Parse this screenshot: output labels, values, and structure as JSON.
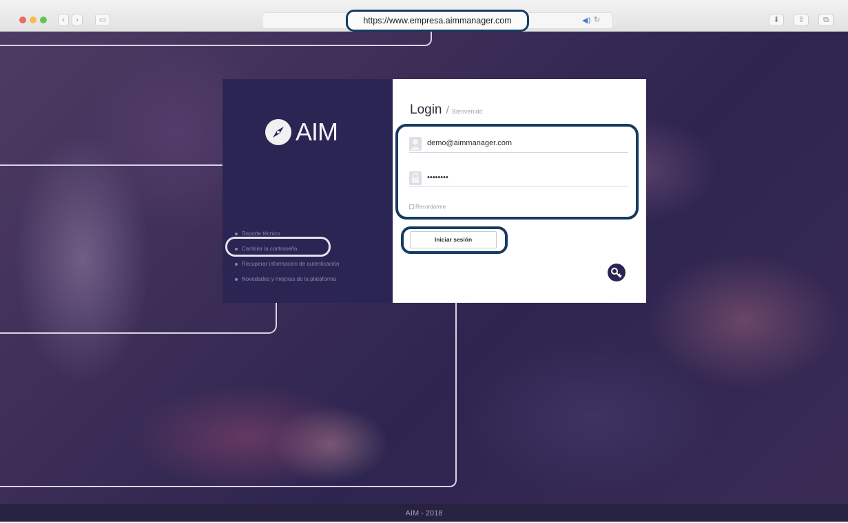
{
  "browser": {
    "url": "https://www.empresa.aimmanager.com",
    "back_glyph": "‹",
    "forward_glyph": "›",
    "sidebar_glyph": "▭",
    "audio_glyph": "◀)",
    "reload_glyph": "↻",
    "download_glyph": "⬇",
    "share_glyph": "⇧",
    "tabs_glyph": "⧉"
  },
  "brand": {
    "logo_text": "AIM",
    "icon": "compass-icon"
  },
  "sidebar_links": [
    "Soporte técnico",
    "Cambiar la contraseña",
    "Recuperar información de autenticación",
    "Novedades y mejoras de la plataforma"
  ],
  "login": {
    "title": "Login",
    "subtitle": "Bienvenido",
    "username_value": "demo@aimmanager.com",
    "password_value": "••••••••",
    "remember_label": "Recordarme",
    "submit_label": "Iniciar sesión",
    "key_glyph": "🔍"
  },
  "footer": {
    "text": "AIM - 2018"
  },
  "colors": {
    "highlight": "#153b62",
    "panel": "#2b2553"
  }
}
